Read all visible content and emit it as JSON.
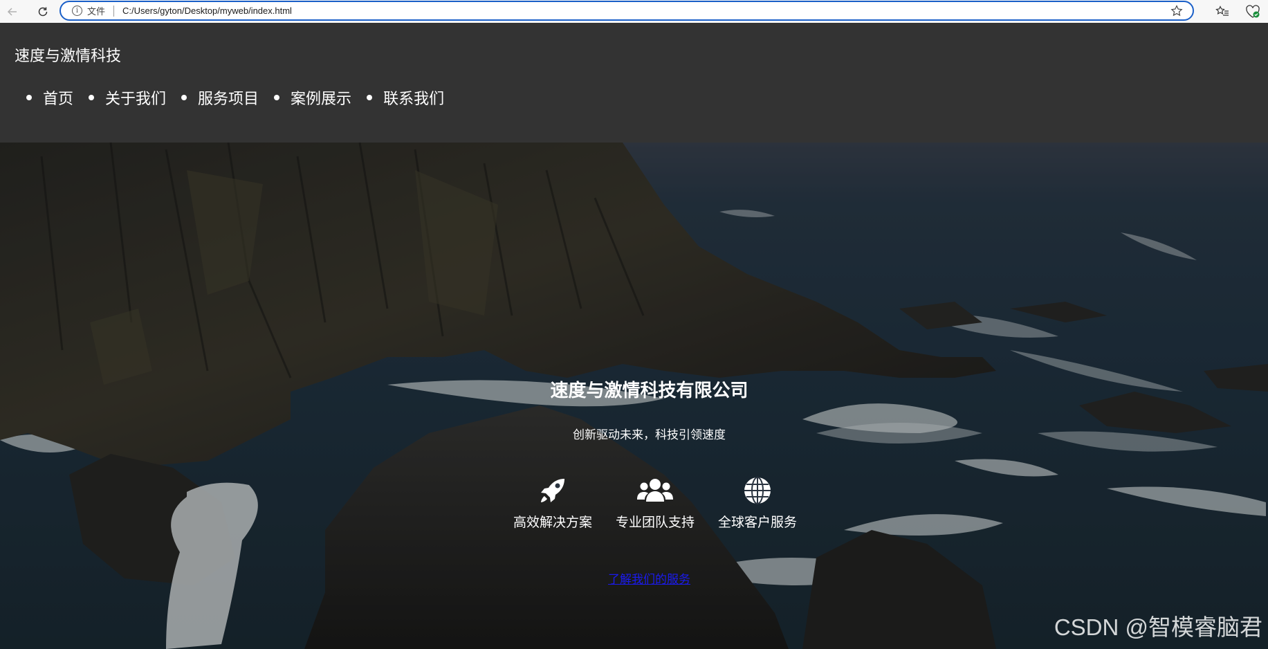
{
  "browser": {
    "site_info_label": "文件",
    "url": "C:/Users/gyton/Desktop/myweb/index.html"
  },
  "header": {
    "logo": "速度与激情科技",
    "nav": [
      {
        "label": "首页"
      },
      {
        "label": "关于我们"
      },
      {
        "label": "服务项目"
      },
      {
        "label": "案例展示"
      },
      {
        "label": "联系我们"
      }
    ]
  },
  "hero": {
    "title": "速度与激情科技有限公司",
    "subtitle": "创新驱动未来，科技引领速度",
    "features": [
      {
        "icon": "rocket-icon",
        "label": "高效解决方案"
      },
      {
        "icon": "users-icon",
        "label": "专业团队支持"
      },
      {
        "icon": "globe-icon",
        "label": "全球客户服务"
      }
    ],
    "cta_label": "了解我们的服务"
  },
  "watermark": "CSDN @智模睿脑君",
  "colors": {
    "header_bg": "#333333",
    "address_border": "#1a5fc8",
    "link": "#1a1aee"
  }
}
